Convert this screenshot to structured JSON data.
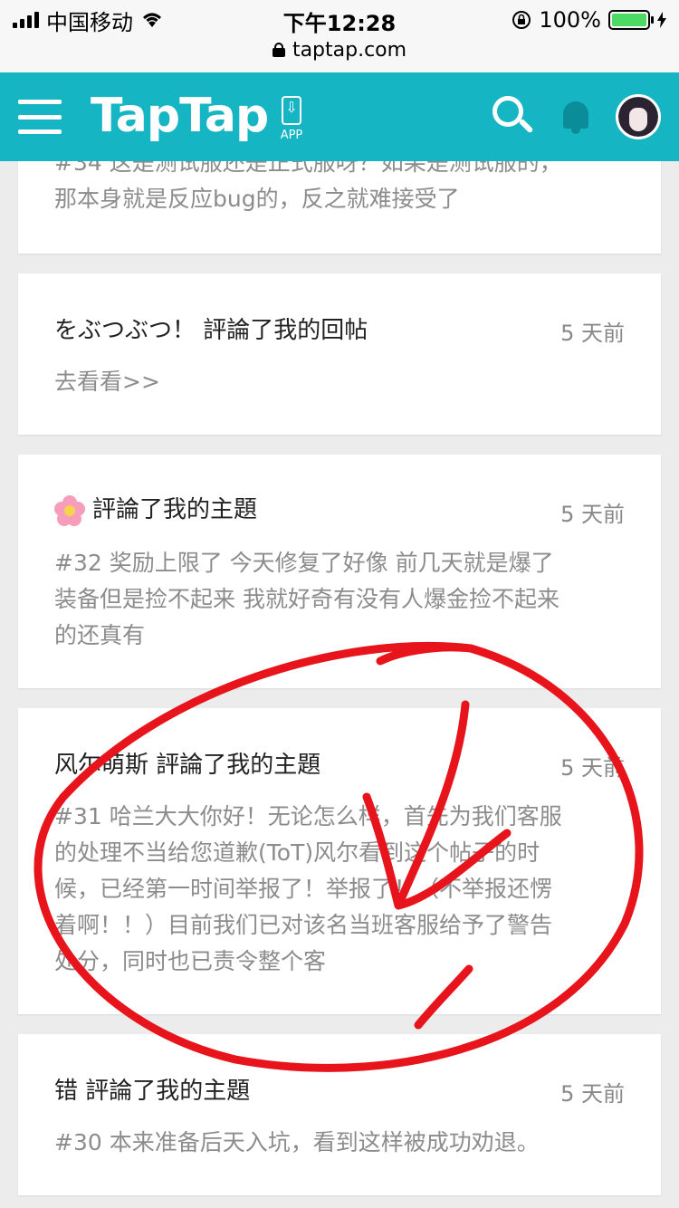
{
  "status_bar": {
    "carrier": "中国移动",
    "time": "下午12:28",
    "battery_pct": "100%",
    "url": "taptap.com"
  },
  "header": {
    "logo": "TapTap",
    "app_label": "APP"
  },
  "feed": [
    {
      "title": "",
      "time": "",
      "body": "#34 这是测试服还是正式服呀？如果是测试服的，\n那本身就是反应bug的，反之就难接受了"
    },
    {
      "title": "をぶつぶつ！ 評論了我的回帖",
      "time": "5 天前",
      "body": "去看看>>"
    },
    {
      "title": "評論了我的主題",
      "time": "5 天前",
      "body": "#32 奖励上限了 今天修复了好像 前几天就是爆了\n装备但是捡不起来 我就好奇有没有人爆金捡不起来\n的还真有"
    },
    {
      "title": "风尔萌斯 評論了我的主題",
      "time": "5 天前",
      "body": "#31 哈兰大大你好！无论怎么样，首先为我们客服\n的处理不当给您道歉(ToT)风尔看到这个帖子的时\n候，已经第一时间举报了！举报了！（不举报还愣\n着啊！！）目前我们已对该名当班客服给予了警告\n处分，同时也已责令整个客"
    },
    {
      "title": "错 評論了我的主題",
      "time": "5 天前",
      "body": "#30 本来准备后天入坑，看到这样被成功劝退。"
    }
  ],
  "colors": {
    "header_bg": "#15b5c3",
    "annotation_red": "#e8141c"
  }
}
